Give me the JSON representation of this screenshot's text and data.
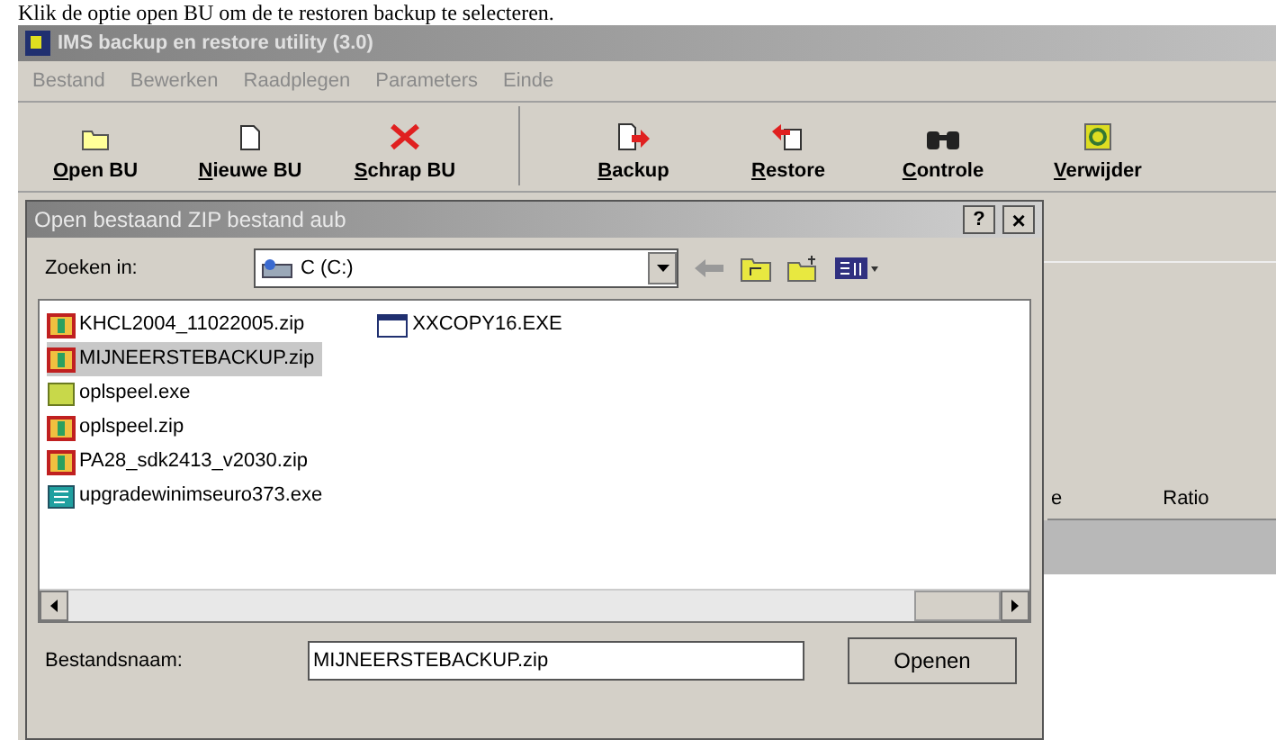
{
  "caption": "Klik de optie open BU om de te restoren backup te selecteren.",
  "window": {
    "title": "IMS backup en restore utility (3.0)"
  },
  "menu": [
    {
      "label": "Bestand",
      "disabled": true
    },
    {
      "label": "Bewerken",
      "disabled": true
    },
    {
      "label": "Raadplegen",
      "disabled": true
    },
    {
      "label": "Parameters",
      "disabled": true
    },
    {
      "label": "Einde",
      "disabled": true
    }
  ],
  "toolbar": [
    {
      "label": "Open BU",
      "kind": "open"
    },
    {
      "label": "Nieuwe BU",
      "kind": "new"
    },
    {
      "label": "Schrap BU",
      "kind": "delete"
    },
    {
      "label": "Backup",
      "kind": "backup"
    },
    {
      "label": "Restore",
      "kind": "restore"
    },
    {
      "label": "Controle",
      "kind": "check"
    },
    {
      "label": "Verwijder",
      "kind": "remove"
    }
  ],
  "list_columns": [
    "e",
    "Ratio"
  ],
  "dialog": {
    "title": "Open bestaand ZIP bestand aub",
    "help": "?",
    "close": "×",
    "look_in_label": "Zoeken in:",
    "look_in_value": "C (C:)",
    "files": [
      {
        "name": "KHCL2004_11022005.zip",
        "kind": "zip",
        "selected": false
      },
      {
        "name": "MIJNEERSTEBACKUP.zip",
        "kind": "zip",
        "selected": true
      },
      {
        "name": "oplspeel.exe",
        "kind": "app",
        "selected": false
      },
      {
        "name": "oplspeel.zip",
        "kind": "zip",
        "selected": false
      },
      {
        "name": "PA28_sdk2413_v2030.zip",
        "kind": "zip",
        "selected": false
      },
      {
        "name": "upgradewinimseuro373.exe",
        "kind": "setup",
        "selected": false
      },
      {
        "name": "XXCOPY16.EXE",
        "kind": "window",
        "selected": false
      }
    ],
    "filename_label": "Bestandsnaam:",
    "filename_value": "MIJNEERSTEBACKUP.zip",
    "open_button": "Openen"
  }
}
